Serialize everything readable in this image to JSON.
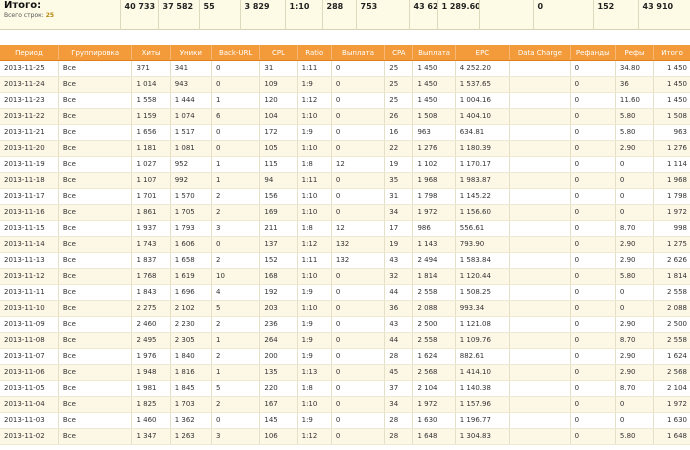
{
  "summary": {
    "title": "Итого:",
    "count_label": "Всего строк:",
    "count_value": "25",
    "values": [
      "40 733",
      "37 582",
      "55",
      "3 829",
      "1:10",
      "288",
      "753",
      "43 622",
      "1 289.60",
      "",
      "0",
      "152",
      "43 910"
    ]
  },
  "columns": [
    "Период",
    "Группировка",
    "Хиты",
    "Уники",
    "Back-URL",
    "CPL",
    "Ratio",
    "Выплата",
    "CPA",
    "Выплата",
    "EPC",
    "Data Charge",
    "Рефанды",
    "Рефы",
    "Итого"
  ],
  "rows": [
    [
      "2013-11-25",
      "Все",
      "371",
      "341",
      "0",
      "31",
      "1:11",
      "0",
      "25",
      "1 450",
      "4 252.20",
      "",
      "0",
      "34.80",
      "1 450"
    ],
    [
      "2013-11-24",
      "Все",
      "1 014",
      "943",
      "0",
      "109",
      "1:9",
      "0",
      "25",
      "1 450",
      "1 537.65",
      "",
      "0",
      "36",
      "1 450"
    ],
    [
      "2013-11-23",
      "Все",
      "1 558",
      "1 444",
      "1",
      "120",
      "1:12",
      "0",
      "25",
      "1 450",
      "1 004.16",
      "",
      "0",
      "11.60",
      "1 450"
    ],
    [
      "2013-11-22",
      "Все",
      "1 159",
      "1 074",
      "6",
      "104",
      "1:10",
      "0",
      "26",
      "1 508",
      "1 404.10",
      "",
      "0",
      "5.80",
      "1 508"
    ],
    [
      "2013-11-21",
      "Все",
      "1 656",
      "1 517",
      "0",
      "172",
      "1:9",
      "0",
      "16",
      "963",
      "634.81",
      "",
      "0",
      "5.80",
      "963"
    ],
    [
      "2013-11-20",
      "Все",
      "1 181",
      "1 081",
      "0",
      "105",
      "1:10",
      "0",
      "22",
      "1 276",
      "1 180.39",
      "",
      "0",
      "2.90",
      "1 276"
    ],
    [
      "2013-11-19",
      "Все",
      "1 027",
      "952",
      "1",
      "115",
      "1:8",
      "12",
      "19",
      "1 102",
      "1 170.17",
      "",
      "0",
      "0",
      "1 114"
    ],
    [
      "2013-11-18",
      "Все",
      "1 107",
      "992",
      "1",
      "94",
      "1:11",
      "0",
      "35",
      "1 968",
      "1 983.87",
      "",
      "0",
      "0",
      "1 968"
    ],
    [
      "2013-11-17",
      "Все",
      "1 701",
      "1 570",
      "2",
      "156",
      "1:10",
      "0",
      "31",
      "1 798",
      "1 145.22",
      "",
      "0",
      "0",
      "1 798"
    ],
    [
      "2013-11-16",
      "Все",
      "1 861",
      "1 705",
      "2",
      "169",
      "1:10",
      "0",
      "34",
      "1 972",
      "1 156.60",
      "",
      "0",
      "0",
      "1 972"
    ],
    [
      "2013-11-15",
      "Все",
      "1 937",
      "1 793",
      "3",
      "211",
      "1:8",
      "12",
      "17",
      "986",
      "556.61",
      "",
      "0",
      "8.70",
      "998"
    ],
    [
      "2013-11-14",
      "Все",
      "1 743",
      "1 606",
      "0",
      "137",
      "1:12",
      "132",
      "19",
      "1 143",
      "793.90",
      "",
      "0",
      "2.90",
      "1 275"
    ],
    [
      "2013-11-13",
      "Все",
      "1 837",
      "1 658",
      "2",
      "152",
      "1:11",
      "132",
      "43",
      "2 494",
      "1 583.84",
      "",
      "0",
      "2.90",
      "2 626"
    ],
    [
      "2013-11-12",
      "Все",
      "1 768",
      "1 619",
      "10",
      "168",
      "1:10",
      "0",
      "32",
      "1 814",
      "1 120.44",
      "",
      "0",
      "5.80",
      "1 814"
    ],
    [
      "2013-11-11",
      "Все",
      "1 843",
      "1 696",
      "4",
      "192",
      "1:9",
      "0",
      "44",
      "2 558",
      "1 508.25",
      "",
      "0",
      "0",
      "2 558"
    ],
    [
      "2013-11-10",
      "Все",
      "2 275",
      "2 102",
      "5",
      "203",
      "1:10",
      "0",
      "36",
      "2 088",
      "993.34",
      "",
      "0",
      "0",
      "2 088"
    ],
    [
      "2013-11-09",
      "Все",
      "2 460",
      "2 230",
      "2",
      "236",
      "1:9",
      "0",
      "43",
      "2 500",
      "1 121.08",
      "",
      "0",
      "2.90",
      "2 500"
    ],
    [
      "2013-11-08",
      "Все",
      "2 495",
      "2 305",
      "1",
      "264",
      "1:9",
      "0",
      "44",
      "2 558",
      "1 109.76",
      "",
      "0",
      "8.70",
      "2 558"
    ],
    [
      "2013-11-07",
      "Все",
      "1 976",
      "1 840",
      "2",
      "200",
      "1:9",
      "0",
      "28",
      "1 624",
      "882.61",
      "",
      "0",
      "2.90",
      "1 624"
    ],
    [
      "2013-11-06",
      "Все",
      "1 948",
      "1 816",
      "1",
      "135",
      "1:13",
      "0",
      "45",
      "2 568",
      "1 414.10",
      "",
      "0",
      "2.90",
      "2 568"
    ],
    [
      "2013-11-05",
      "Все",
      "1 981",
      "1 845",
      "5",
      "220",
      "1:8",
      "0",
      "37",
      "2 104",
      "1 140.38",
      "",
      "0",
      "8.70",
      "2 104"
    ],
    [
      "2013-11-04",
      "Все",
      "1 825",
      "1 703",
      "2",
      "167",
      "1:10",
      "0",
      "34",
      "1 972",
      "1 157.96",
      "",
      "0",
      "0",
      "1 972"
    ],
    [
      "2013-11-03",
      "Все",
      "1 460",
      "1 362",
      "0",
      "145",
      "1:9",
      "0",
      "28",
      "1 630",
      "1 196.77",
      "",
      "0",
      "0",
      "1 630"
    ],
    [
      "2013-11-02",
      "Все",
      "1 347",
      "1 263",
      "3",
      "106",
      "1:12",
      "0",
      "28",
      "1 648",
      "1 304.83",
      "",
      "0",
      "5.80",
      "1 648"
    ]
  ]
}
